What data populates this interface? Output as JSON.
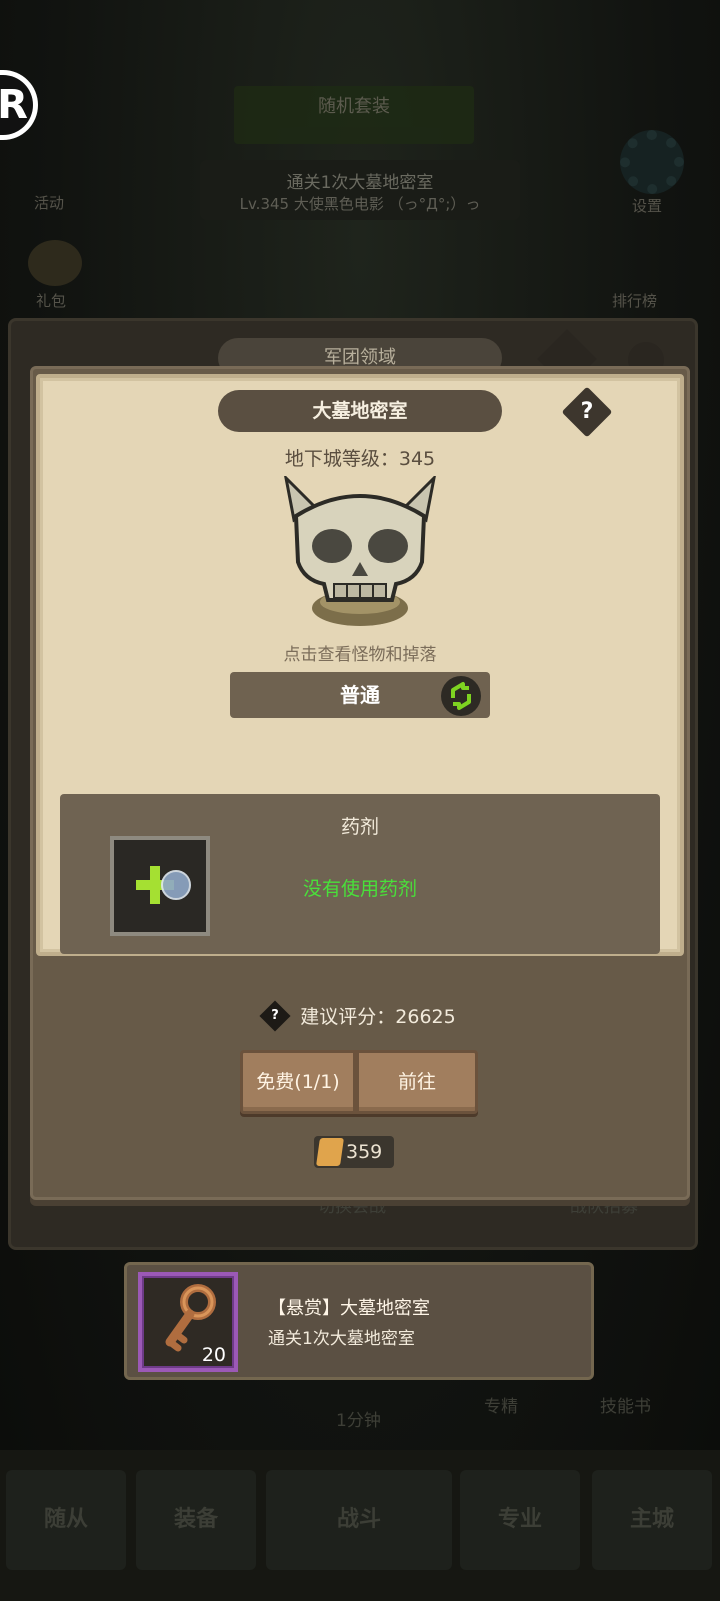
{
  "background": {
    "top_button": "随机套装",
    "quest_title": "通关1次大墓地密室",
    "quest_sub": "Lv.345 大使黑色电影 （っ°Д°;）っ",
    "left_label_1": "活动",
    "left_label_2": "礼包",
    "right_label_1": "设置",
    "right_label_2": "排行榜",
    "legion_title": "军团领域",
    "bottom_left_label": "切换会战",
    "bottom_right_label": "战队招募",
    "timer": "1分钟",
    "mid_label_1": "专精",
    "mid_label_2": "技能书",
    "nav": [
      "随从",
      "装备",
      "战斗",
      "专业",
      "主城"
    ]
  },
  "dialog": {
    "title": "大墓地密室",
    "help_symbol": "?",
    "dungeon_level": "地下城等级：345",
    "hint": "点击查看怪物和掉落",
    "mode": "普通",
    "potion": {
      "title": "药剂",
      "status": "没有使用药剂",
      "status_color": "#49e03a"
    },
    "score_help": "?",
    "recommended_score": "建议评分：26625",
    "buttons": {
      "free": "免费(1/1)",
      "go": "前往"
    },
    "ticket_count": "359"
  },
  "reward": {
    "title": "【悬赏】大墓地密室",
    "desc": "通关1次大墓地密室",
    "count": "20",
    "icon": "key-icon",
    "rarity_color": "#9b59b6"
  }
}
